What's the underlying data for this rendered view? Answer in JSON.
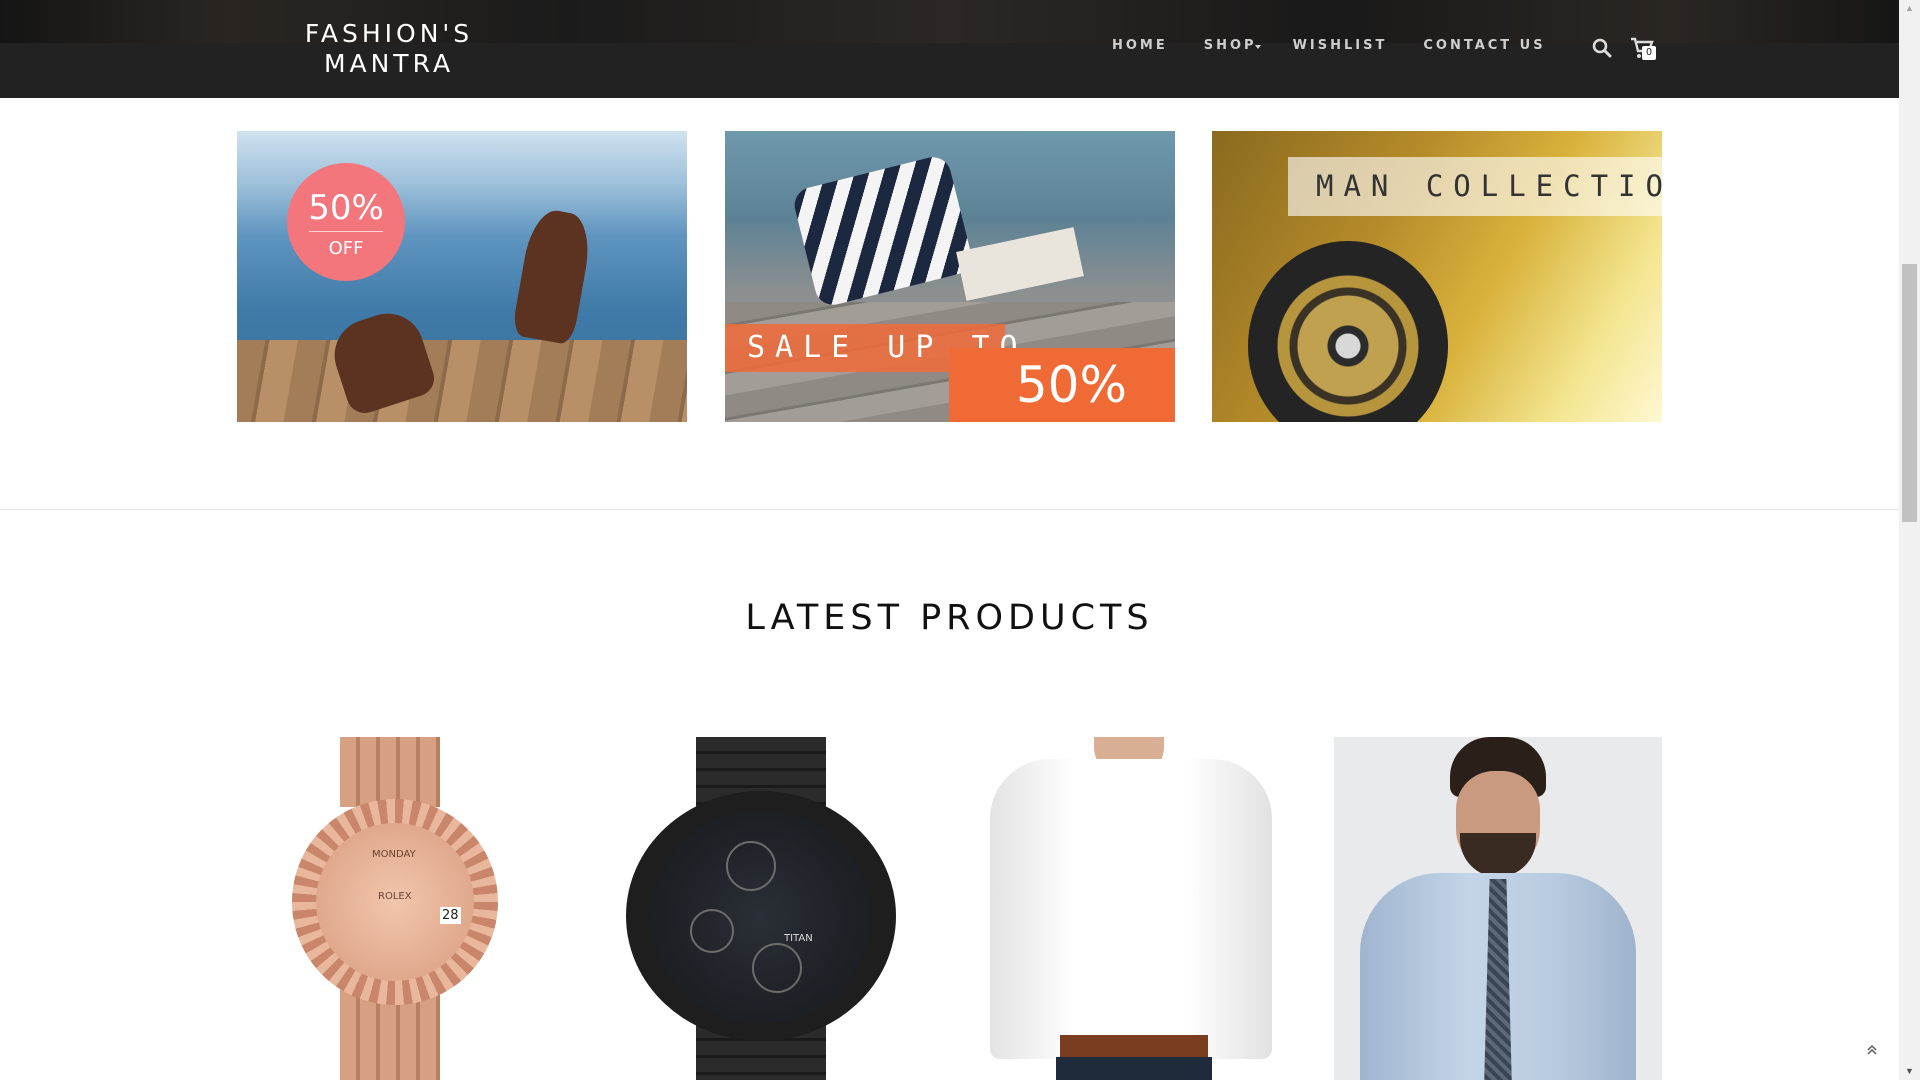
{
  "header": {
    "brand_line1": "FASHION'S",
    "brand_line2": "MANTRA",
    "nav": [
      {
        "label": "HOME"
      },
      {
        "label": "SHOP"
      },
      {
        "label": "WISHLIST"
      },
      {
        "label": "CONTACT US"
      }
    ],
    "cart_count": "0"
  },
  "banners": {
    "discount": {
      "percent": "50%",
      "off": "OFF"
    },
    "sale": {
      "text": "SALE UP TO",
      "percent": "50%"
    },
    "collection": {
      "label": "MAN COLLECTION"
    }
  },
  "latest": {
    "title": "LATEST PRODUCTS"
  },
  "products": {
    "watch1": {
      "date": "28",
      "day": "MONDAY",
      "brand": "ROLEX"
    },
    "watch2": {
      "brand": "TITAN"
    }
  },
  "colors": {
    "header_bg": "#222222",
    "badge_pink": "#f4767d",
    "sale_orange": "#f06a35"
  },
  "icons": {
    "search": "search-icon",
    "cart": "cart-icon",
    "back_to_top": "chevron-double-up-icon"
  }
}
